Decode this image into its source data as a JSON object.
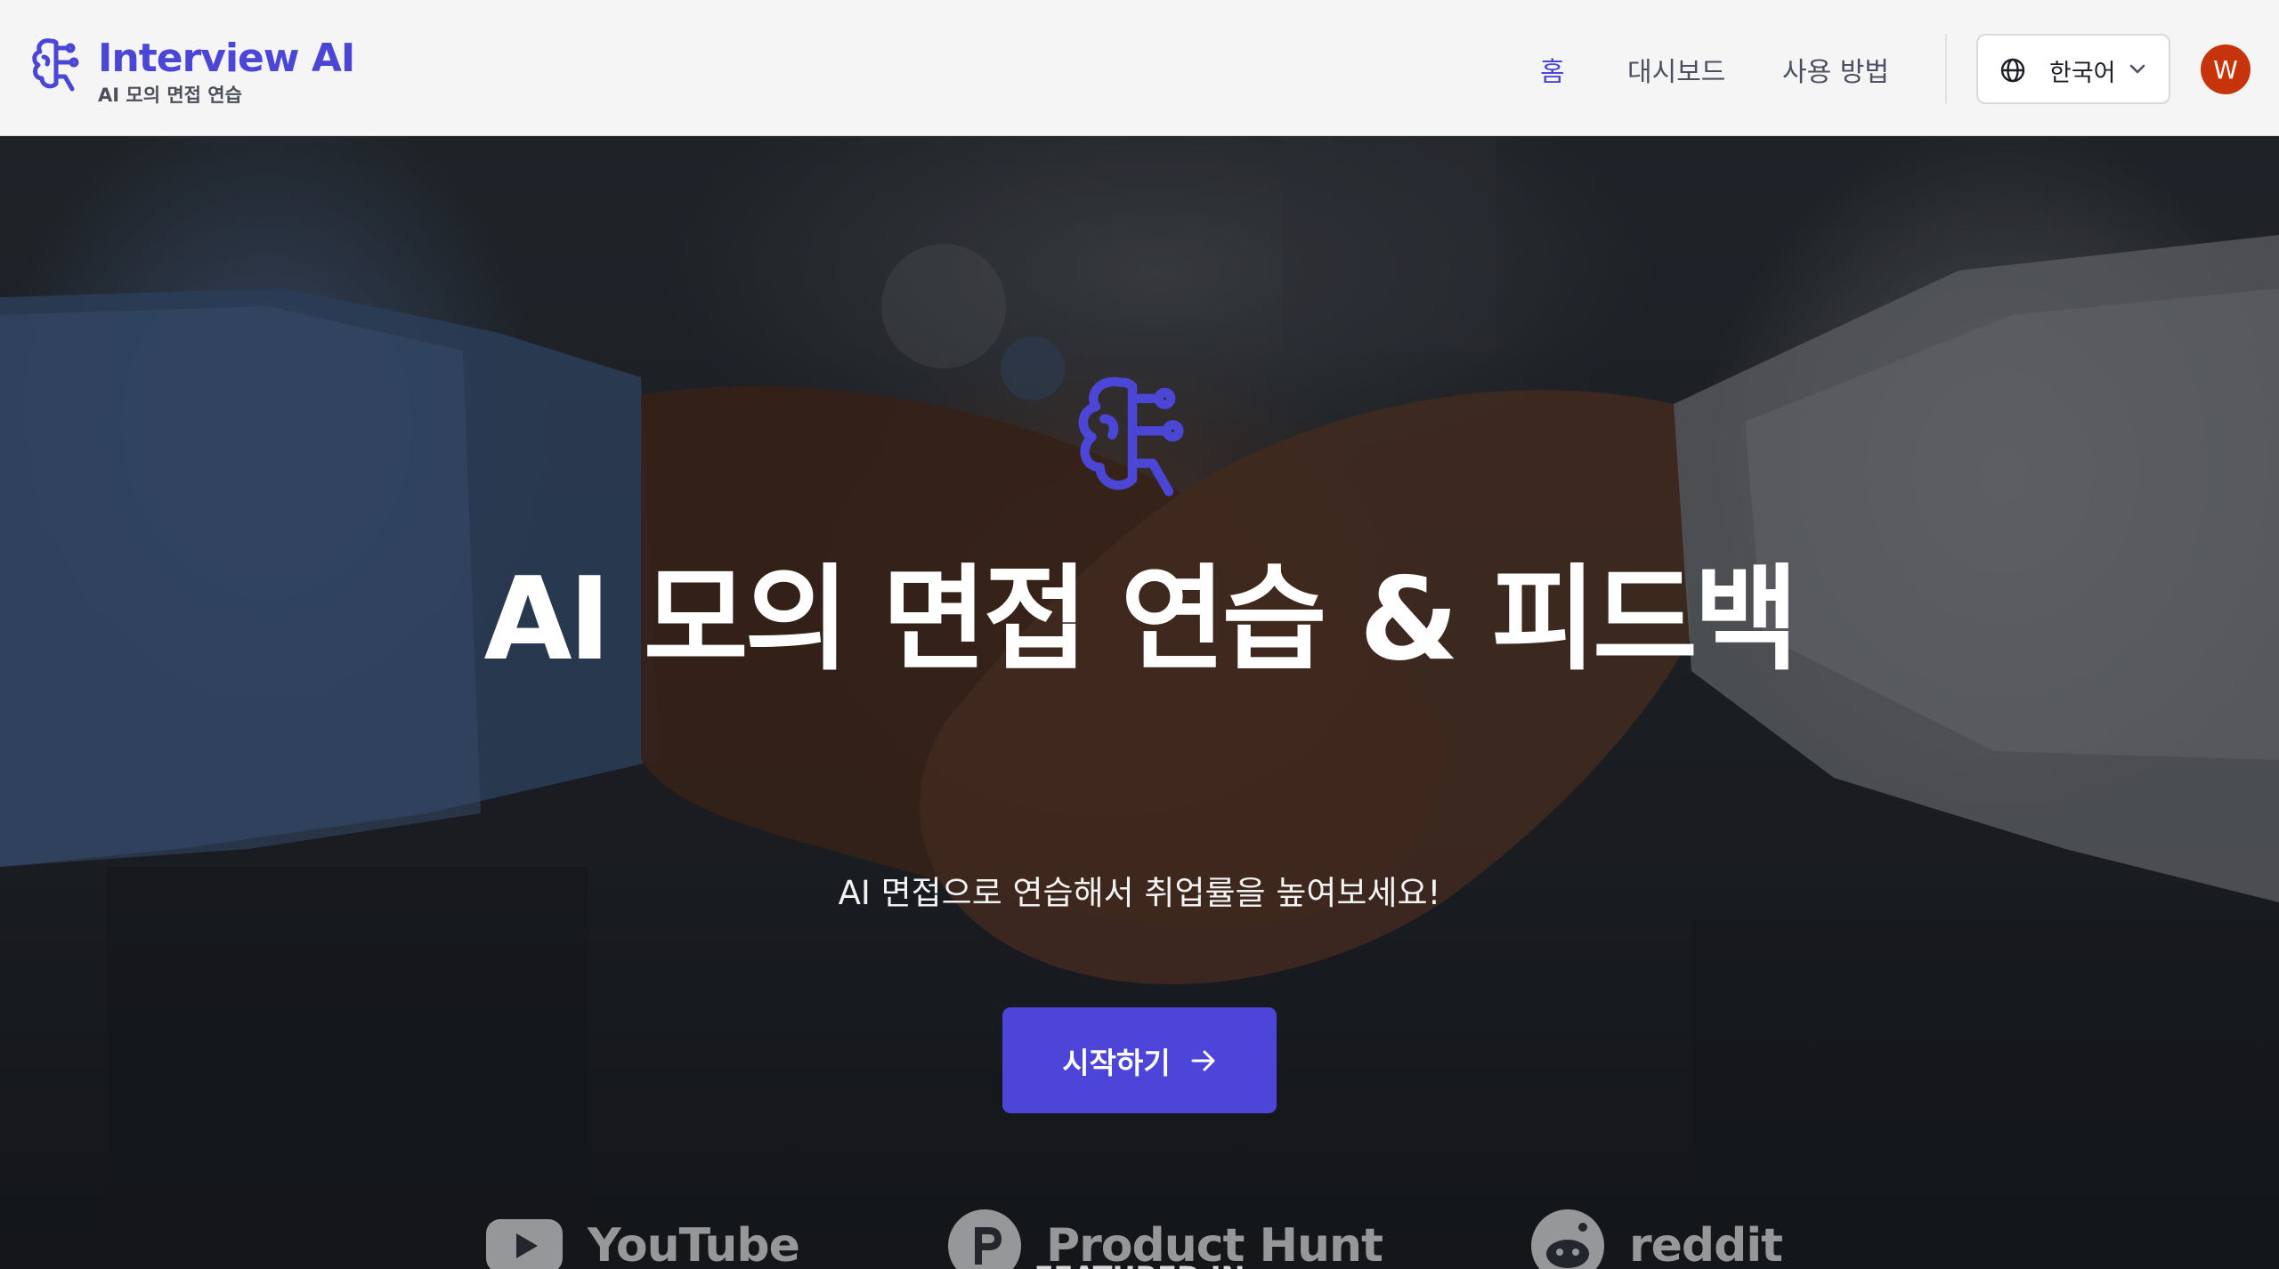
{
  "header": {
    "brand_name": "Interview AI",
    "brand_tagline": "AI 모의 면접 연습",
    "nav": {
      "home": "홈",
      "dashboard": "대시보드",
      "how_to_use": "사용 방법"
    },
    "active_nav": "home",
    "language": "한국어",
    "avatar_initial": "W"
  },
  "hero": {
    "title": "AI 모의 면접 연습 & 피드백",
    "subtitle": "AI 면접으로 연습해서 취업률을 높여보세요!",
    "cta_label": "시작하기",
    "featured_label": "FEATURED IN",
    "featured": [
      {
        "name": "YouTube",
        "icon": "youtube-icon"
      },
      {
        "name": "Product Hunt",
        "icon": "product-hunt-icon"
      },
      {
        "name": "reddit",
        "icon": "reddit-icon"
      }
    ]
  },
  "colors": {
    "brand": "#4b46d6",
    "cta": "#4d44d8",
    "avatar": "#c7330b",
    "header_bg": "#f5f5f5"
  }
}
